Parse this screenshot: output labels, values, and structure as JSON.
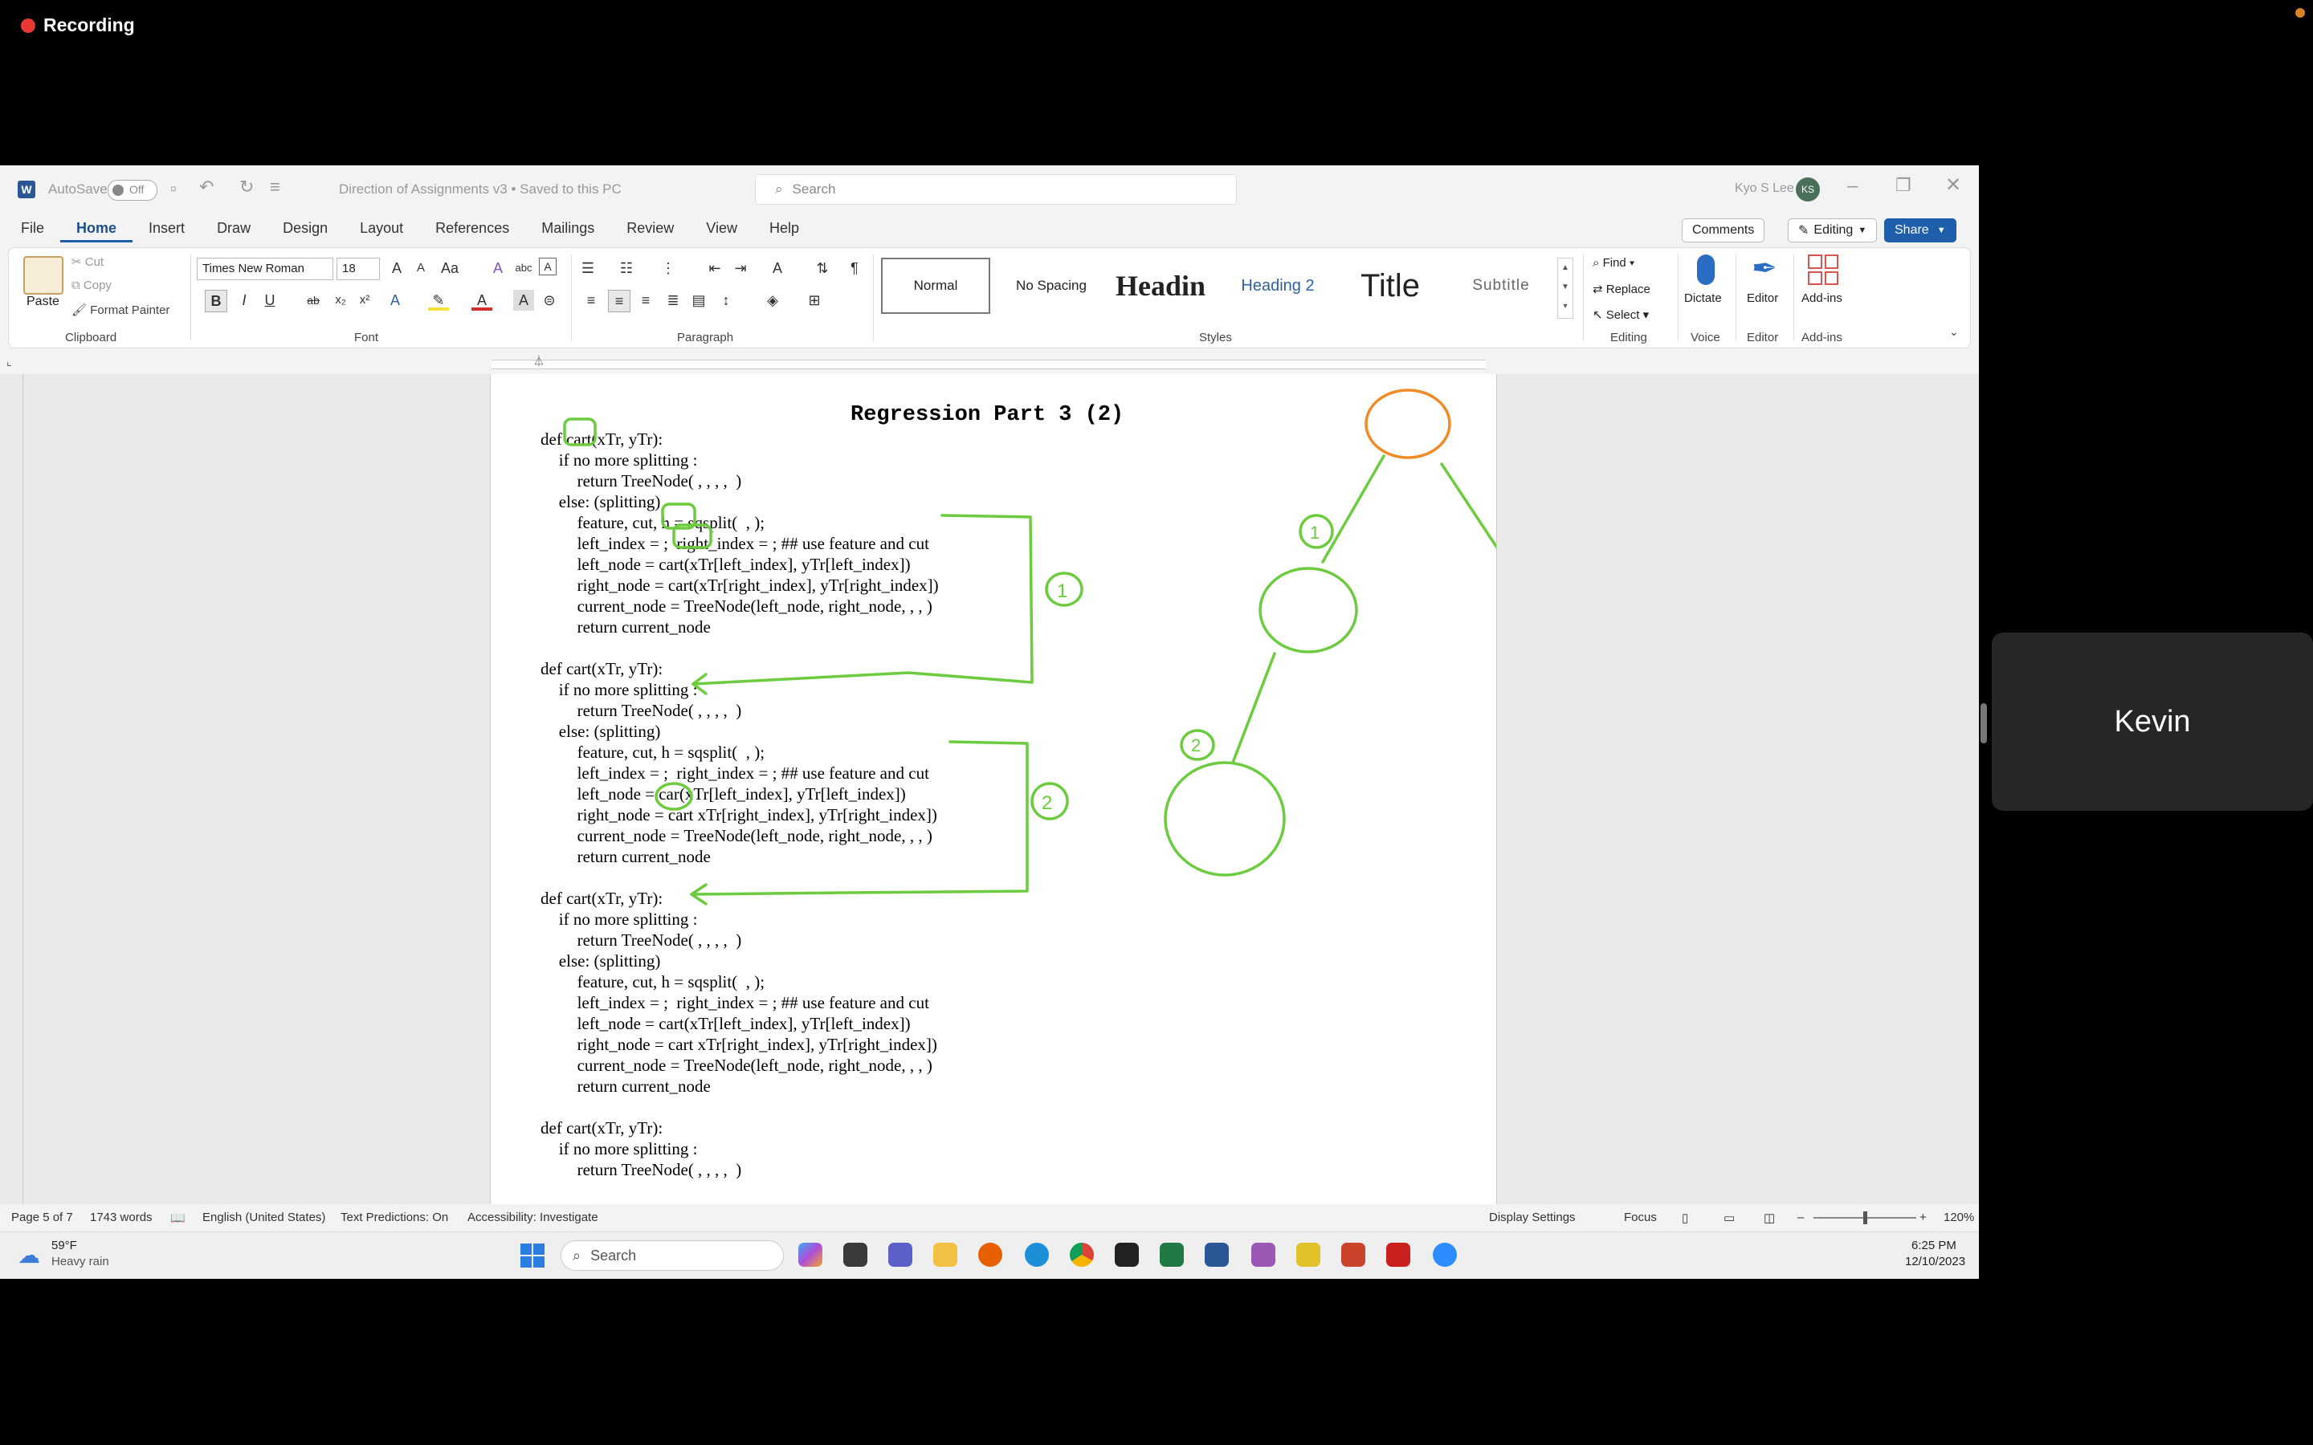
{
  "recording": {
    "label": "Recording"
  },
  "window": {
    "autosave_label": "AutoSave",
    "autosave_state": "Off",
    "doc_title": "Direction of Assignments v3 • Saved to this PC",
    "search_placeholder": "Search",
    "user_name": "Kyo S Lee",
    "user_initials": "KS"
  },
  "tabs": [
    "File",
    "Home",
    "Insert",
    "Draw",
    "Design",
    "Layout",
    "References",
    "Mailings",
    "Review",
    "View",
    "Help"
  ],
  "ribbon_right": {
    "comments": "Comments",
    "editing": "Editing",
    "share": "Share"
  },
  "ribbon": {
    "clipboard": {
      "paste": "Paste",
      "cut": "Cut",
      "copy": "Copy",
      "format_painter": "Format Painter",
      "label": "Clipboard"
    },
    "font": {
      "name": "Times New Roman",
      "size": "18",
      "label": "Font"
    },
    "paragraph": {
      "label": "Paragraph"
    },
    "styles": {
      "items": [
        "Normal",
        "No Spacing",
        "Headin",
        "Heading 2",
        "Title",
        "Subtitle"
      ],
      "label": "Styles"
    },
    "editing": {
      "find": "Find",
      "replace": "Replace",
      "select": "Select",
      "label": "Editing"
    },
    "voice": {
      "dictate": "Dictate",
      "label": "Voice"
    },
    "editor": {
      "editor": "Editor",
      "label": "Editor"
    },
    "addins": {
      "addins": "Add-ins",
      "label": "Add-ins"
    }
  },
  "document": {
    "title": "Regression Part 3 (2)",
    "blocks": [
      [
        "def cart(xTr, yTr):",
        "    if no more splitting :",
        "        return TreeNode( , , , ,  )",
        "    else: (splitting)",
        "        feature, cut, h = sqsplit(  , );",
        "        left_index = ;  right_index = ; ## use feature and cut",
        "        left_node = cart(xTr[left_index], yTr[left_index])",
        "        right_node = cart(xTr[right_index], yTr[right_index])",
        "        current_node = TreeNode(left_node, right_node, , , )",
        "        return current_node"
      ],
      [
        "def cart(xTr, yTr):",
        "    if no more splitting :",
        "        return TreeNode( , , , ,  )",
        "    else: (splitting)",
        "        feature, cut, h = sqsplit(  , );",
        "        left_index = ;  right_index = ; ## use feature and cut",
        "        left_node = car(xTr[left_index], yTr[left_index])",
        "        right_node = cart xTr[right_index], yTr[right_index])",
        "        current_node = TreeNode(left_node, right_node, , , )",
        "        return current_node"
      ],
      [
        "def cart(xTr, yTr):",
        "    if no more splitting :",
        "        return TreeNode( , , , ,  )",
        "    else: (splitting)",
        "        feature, cut, h = sqsplit(  , );",
        "        left_index = ;  right_index = ; ## use feature and cut",
        "        left_node = cart(xTr[left_index], yTr[left_index])",
        "        right_node = cart xTr[right_index], yTr[right_index])",
        "        current_node = TreeNode(left_node, right_node, , , )",
        "        return current_node"
      ],
      [
        "def cart(xTr, yTr):",
        "    if no more splitting :",
        "        return TreeNode( , , , ,  )"
      ]
    ],
    "annotations": [
      "1",
      "1",
      "2",
      "2"
    ]
  },
  "status": {
    "page": "Page 5 of 7",
    "words": "1743 words",
    "language": "English (United States)",
    "predictions": "Text Predictions: On",
    "accessibility": "Accessibility: Investigate",
    "display": "Display Settings",
    "focus": "Focus",
    "zoom": "120%"
  },
  "taskbar": {
    "weather_temp": "59°F",
    "weather_desc": "Heavy rain",
    "search": "Search",
    "time": "6:25 PM",
    "date": "12/10/2023"
  },
  "participant": {
    "name": "Kevin"
  }
}
